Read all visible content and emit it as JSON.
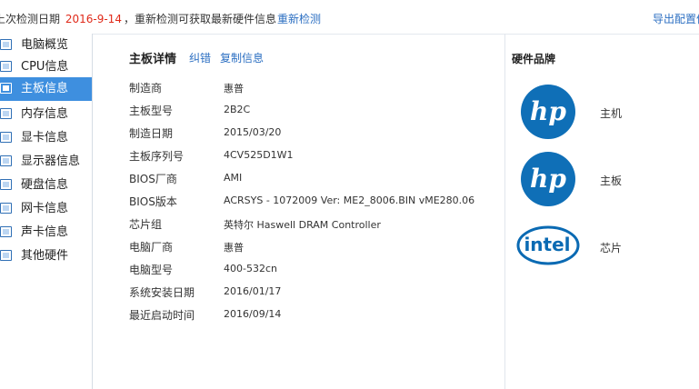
{
  "topbar": {
    "last_check_prefix": "上次检测日期",
    "last_check_date": "2016-9-14",
    "hint": "，重新检测可获取最新硬件信息",
    "recheck": "重新检测",
    "export": "导出配置信"
  },
  "sidebar": {
    "items": [
      {
        "label": "电脑概览",
        "icon": "computer-icon"
      },
      {
        "label": "CPU信息",
        "icon": "cpu-icon"
      },
      {
        "label": "主板信息",
        "icon": "motherboard-icon",
        "active": true
      },
      {
        "label": "内存信息",
        "icon": "memory-icon"
      },
      {
        "label": "显卡信息",
        "icon": "gpu-icon"
      },
      {
        "label": "显示器信息",
        "icon": "monitor-icon"
      },
      {
        "label": "硬盘信息",
        "icon": "disk-icon"
      },
      {
        "label": "网卡信息",
        "icon": "network-card-icon"
      },
      {
        "label": "声卡信息",
        "icon": "sound-card-icon"
      },
      {
        "label": "其他硬件",
        "icon": "other-hardware-icon"
      }
    ]
  },
  "main": {
    "title": "主板详情",
    "actions": {
      "report": "纠错",
      "copy": "复制信息"
    },
    "rows": [
      {
        "key": "制造商",
        "value": "惠普"
      },
      {
        "key": "主板型号",
        "value": "2B2C"
      },
      {
        "key": "制造日期",
        "value": "2015/03/20"
      },
      {
        "key": "主板序列号",
        "value": "4CV525D1W1"
      },
      {
        "key": "BIOS厂商",
        "value": "AMI"
      },
      {
        "key": "BIOS版本",
        "value": "ACRSYS - 1072009 Ver: ME2_8006.BIN vME280.06"
      },
      {
        "key": "芯片组",
        "value": "英特尔 Haswell DRAM Controller"
      },
      {
        "key": "电脑厂商",
        "value": "惠普"
      },
      {
        "key": "电脑型号",
        "value": "400-532cn"
      },
      {
        "key": "系统安装日期",
        "value": "2016/01/17"
      },
      {
        "key": "最近启动时间",
        "value": "2016/09/14"
      }
    ]
  },
  "brands": {
    "title": "硬件品牌",
    "items": [
      {
        "label": "主机",
        "logo_text": "hp",
        "logo": "hp-logo"
      },
      {
        "label": "主板",
        "logo_text": "hp",
        "logo": "hp-logo"
      },
      {
        "label": "芯片",
        "logo_text": "intel",
        "logo": "intel-logo"
      }
    ]
  },
  "colors": {
    "accent": "#3e8fdf",
    "link": "#2c6fc2",
    "date": "#e02a1a",
    "hp_blue": "#0f6fb7",
    "intel_blue": "#0a6ab3"
  }
}
